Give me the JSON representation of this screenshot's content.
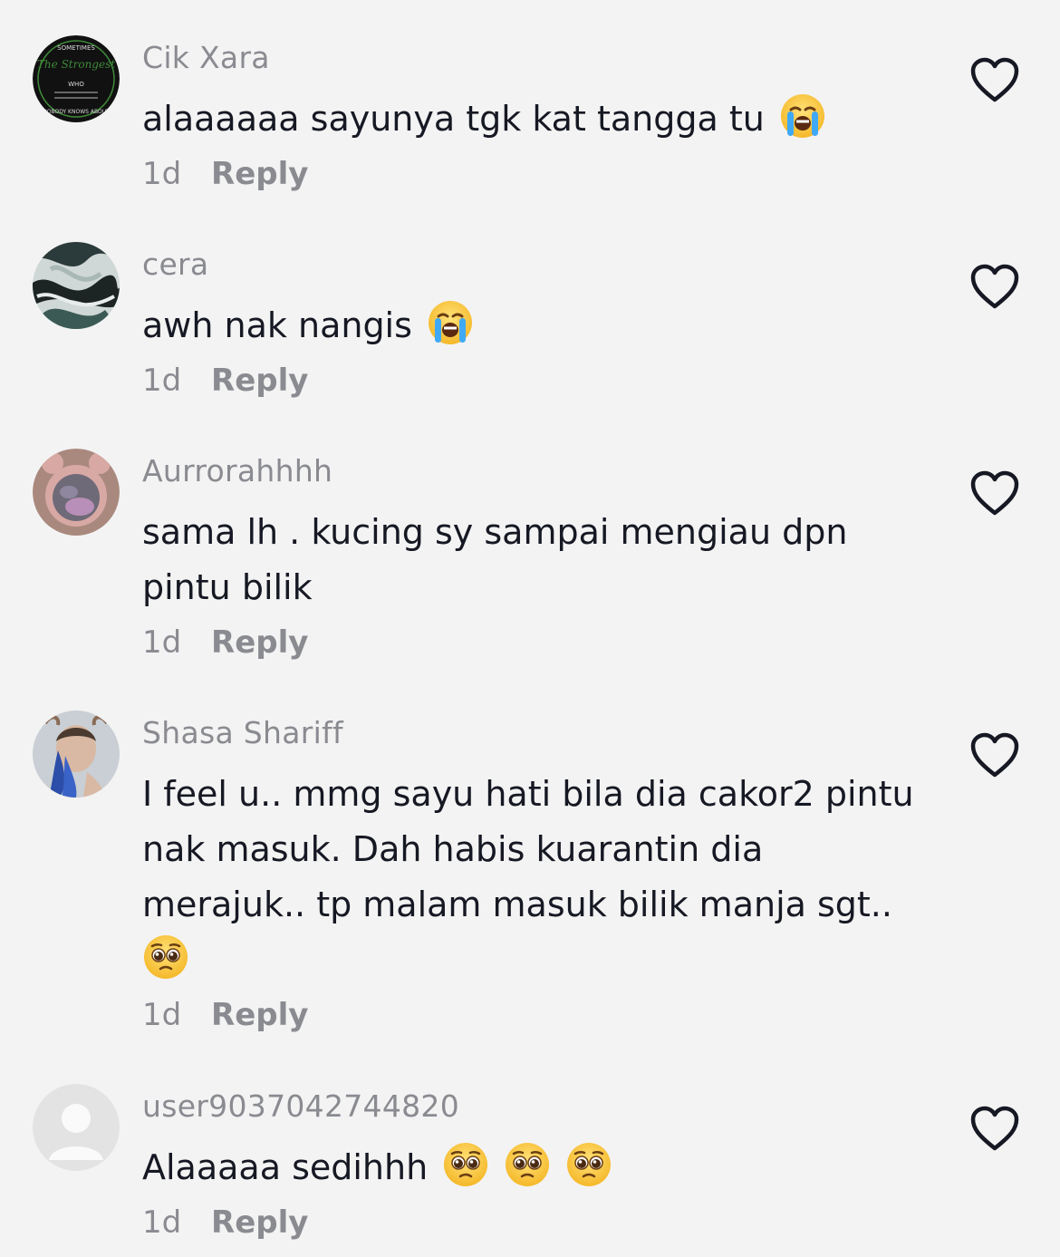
{
  "comments": [
    {
      "username": "Cik Xara",
      "text": "alaaaaaa sayunya tgk kat tangga tu",
      "emojis": [
        "loudly-crying-face"
      ],
      "time": "1d",
      "reply": "Reply",
      "avatar": "the-strongest-badge",
      "avatar_text": [
        "SOMETIMES",
        "The Strongest",
        "WHO",
        "NOBODY KNOWS ABOUT"
      ]
    },
    {
      "username": "cera",
      "text": "awh nak nangis",
      "emojis": [
        "loudly-crying-face"
      ],
      "time": "1d",
      "reply": "Reply",
      "avatar": "marbled-abstract"
    },
    {
      "username": "Aurrorahhhh",
      "text": "sama lh . kucing sy sampai mengiau dpn pintu bilik",
      "emojis": [],
      "time": "1d",
      "reply": "Reply",
      "avatar": "pink-bear-frame-photo"
    },
    {
      "username": "Shasa Shariff",
      "text": "I feel u.. mmg sayu hati bila dia cakor2 pintu nak masuk. Dah habis kuarantin dia merajuk.. tp malam masuk bilik manja sgt..",
      "emojis": [
        "pleading-face"
      ],
      "time": "1d",
      "reply": "Reply",
      "avatar": "blue-painted-face-portrait"
    },
    {
      "username": "user9037042744820",
      "text": "Alaaaaa sedihhh",
      "emojis": [
        "pleading-face",
        "pleading-face",
        "pleading-face"
      ],
      "time": "1d",
      "reply": "Reply",
      "avatar": "default-user-placeholder"
    }
  ],
  "like_icon": "heart-outline-icon",
  "colors": {
    "background": "#f3f3f3",
    "text": "#161823",
    "secondary": "#8a8b91",
    "badge_green": "#3f8a3a"
  }
}
